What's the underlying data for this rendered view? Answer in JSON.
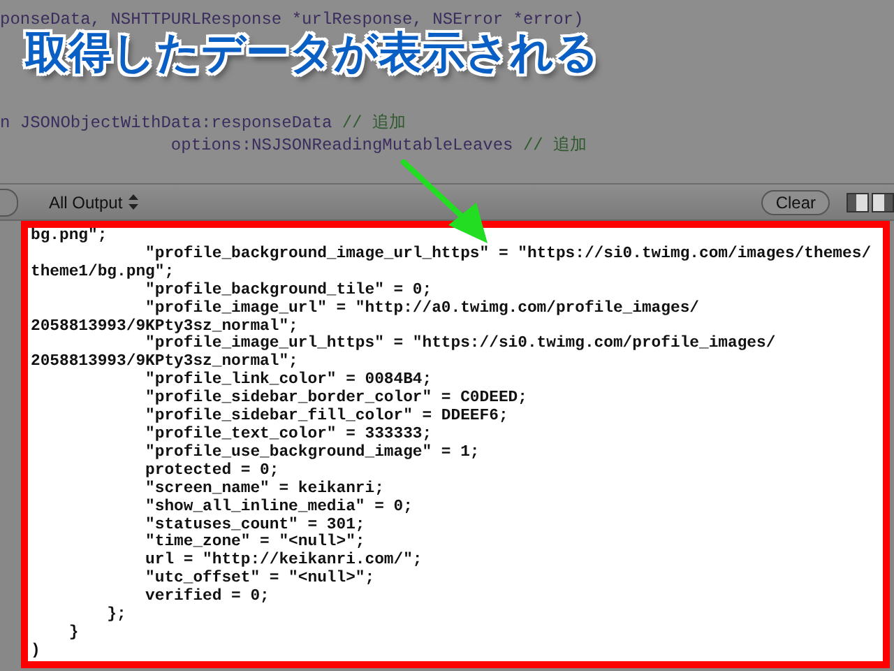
{
  "editor": {
    "code_lines": [
      {
        "code": "ponseData, NSHTTPURLResponse *urlResponse, NSError *error)"
      },
      {
        "code": "n JSONObjectWithData:responseData ",
        "comment": "// 追加"
      },
      {
        "code": "                 options:NSJSONReadingMutableLeaves ",
        "comment": "// 追加"
      }
    ]
  },
  "callout": {
    "text": "取得したデータが表示される"
  },
  "console_toolbar": {
    "filter": "All Output",
    "clear_button": "Clear"
  },
  "console": {
    "lines": [
      "bg.png\";",
      "            \"profile_background_image_url_https\" = \"https://si0.twimg.com/images/themes/",
      "theme1/bg.png\";",
      "            \"profile_background_tile\" = 0;",
      "            \"profile_image_url\" = \"http://a0.twimg.com/profile_images/",
      "2058813993/9KPty3sz_normal\";",
      "            \"profile_image_url_https\" = \"https://si0.twimg.com/profile_images/",
      "2058813993/9KPty3sz_normal\";",
      "            \"profile_link_color\" = 0084B4;",
      "            \"profile_sidebar_border_color\" = C0DEED;",
      "            \"profile_sidebar_fill_color\" = DDEEF6;",
      "            \"profile_text_color\" = 333333;",
      "            \"profile_use_background_image\" = 1;",
      "            protected = 0;",
      "            \"screen_name\" = keikanri;",
      "            \"show_all_inline_media\" = 0;",
      "            \"statuses_count\" = 301;",
      "            \"time_zone\" = \"<null>\";",
      "            url = \"http://keikanri.com/\";",
      "            \"utc_offset\" = \"<null>\";",
      "            verified = 0;",
      "        };",
      "    }",
      ")"
    ]
  }
}
